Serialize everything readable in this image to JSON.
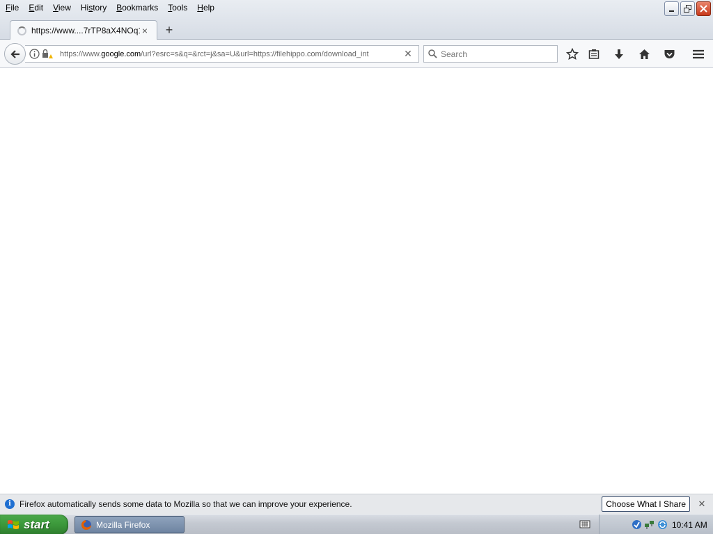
{
  "window": {
    "menu": [
      {
        "accel": "F",
        "rest": "ile"
      },
      {
        "accel": "E",
        "rest": "dit"
      },
      {
        "accel": "V",
        "rest": "iew"
      },
      {
        "pre": "Hi",
        "accel": "s",
        "rest": "tory"
      },
      {
        "accel": "B",
        "rest": "ookmarks"
      },
      {
        "accel": "T",
        "rest": "ools"
      },
      {
        "accel": "H",
        "rest": "elp"
      }
    ],
    "controls": [
      "minimize-icon",
      "restore-icon",
      "close-icon"
    ]
  },
  "tab": {
    "title": "https://www....7rTP8aX4NOq1",
    "close": "×",
    "new_tab": "+"
  },
  "navbar": {
    "url_prefix": "https://www.",
    "url_domain": "google.com",
    "url_rest": "/url?esrc=s&q=&rct=j&sa=U&url=https://filehippo.com/download_int",
    "url_clear": "✕",
    "search_placeholder": "Search"
  },
  "notification": {
    "text": "Firefox automatically sends some data to Mozilla so that we can improve your experience.",
    "button": "Choose What I Share",
    "close": "✕"
  },
  "taskbar": {
    "start": "start",
    "task": "Mozilla Firefox",
    "clock": "10:41 AM"
  },
  "colors": {
    "start_green": "#3d9a3c",
    "info_blue": "#1f6fd1",
    "close_red": "#c7391b"
  }
}
